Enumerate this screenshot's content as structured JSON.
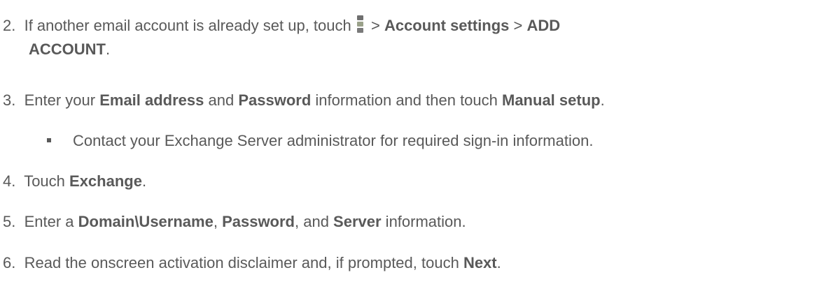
{
  "steps": [
    {
      "number": "2.",
      "text_a": "If another email account is already set up, touch ",
      "icon": "menu-icon",
      "text_b": " > ",
      "bold_a": "Account settings",
      "text_c": " > ",
      "bold_b": "ADD",
      "bold_c": "ACCOUNT",
      "text_d": "."
    },
    {
      "number": "3.",
      "text_a": "Enter your ",
      "bold_a": "Email address",
      "text_b": " and ",
      "bold_b": "Password",
      "text_c": " information and then touch ",
      "bold_c": "Manual setup",
      "text_d": "."
    },
    {
      "sub_bullet": "Contact your Exchange Server administrator for required sign-in information."
    },
    {
      "number": "4.",
      "text_a": "Touch ",
      "bold_a": "Exchange",
      "text_b": "."
    },
    {
      "number": "5.",
      "text_a": "Enter a ",
      "bold_a": "Domain\\Username",
      "text_b": ", ",
      "bold_b": "Password",
      "text_c": ", and ",
      "bold_c": "Server",
      "text_d": " information."
    },
    {
      "number": "6.",
      "text_a": "Read the onscreen activation disclaimer and, if prompted, touch ",
      "bold_a": "Next",
      "text_b": "."
    }
  ],
  "colors": {
    "text": "#595959",
    "background": "#ffffff"
  }
}
